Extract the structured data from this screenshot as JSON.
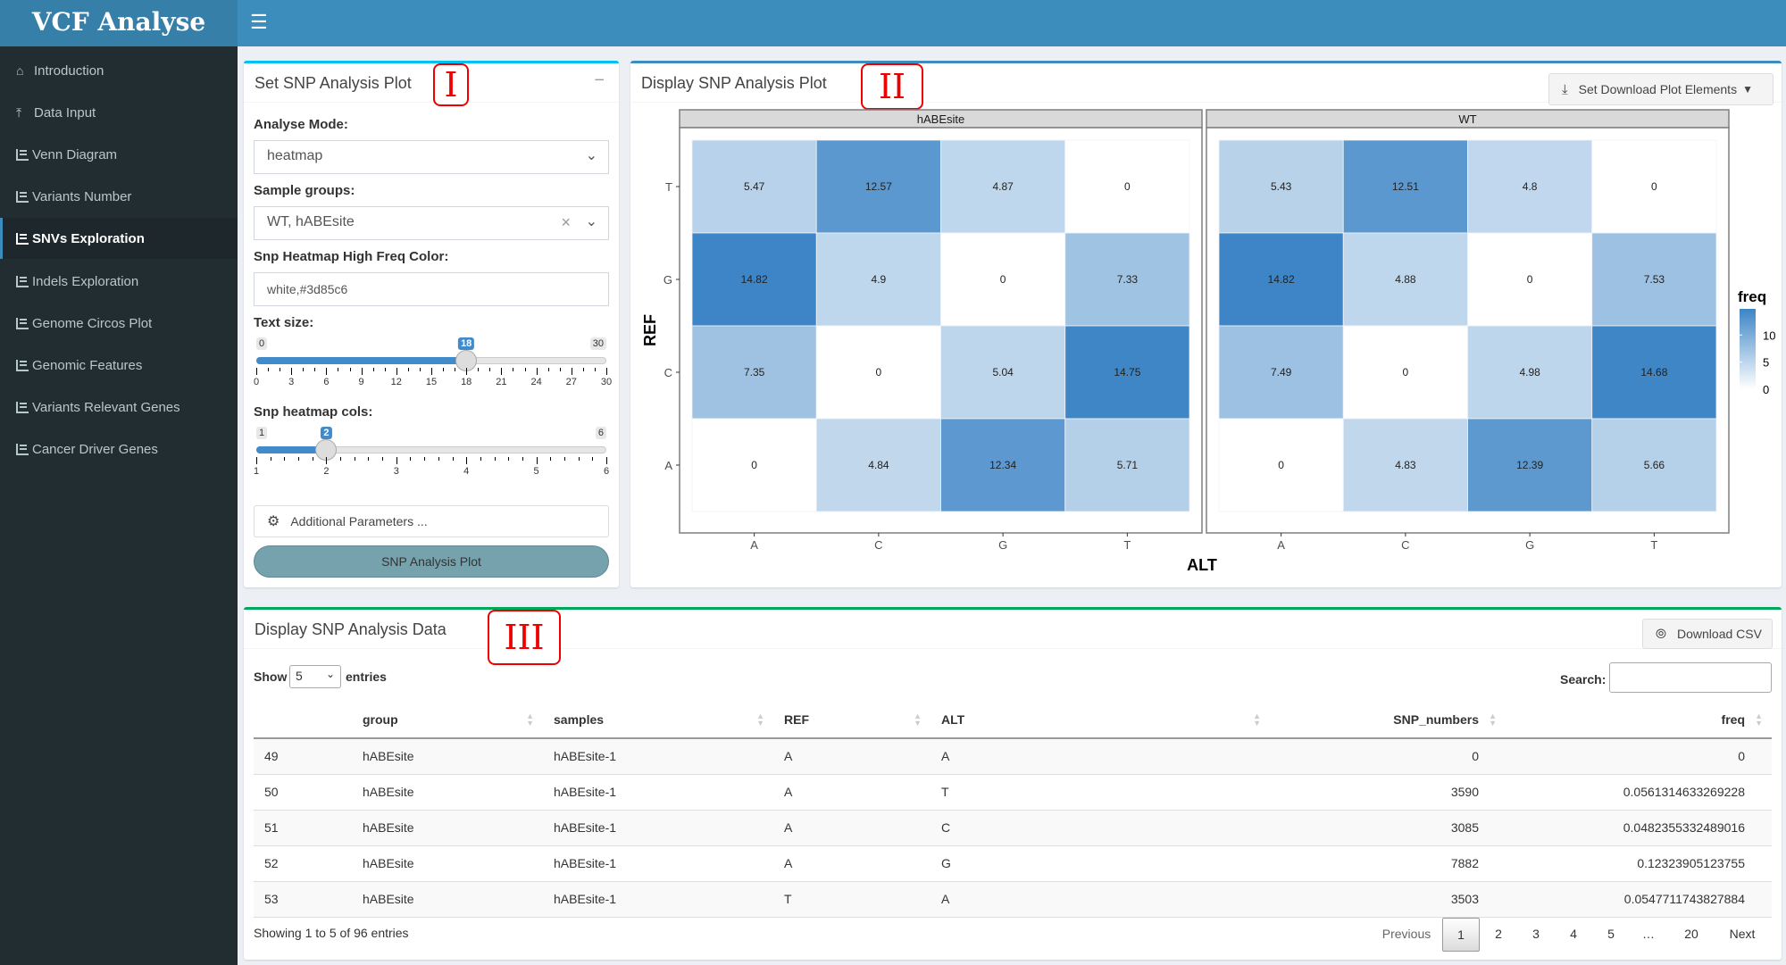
{
  "app": {
    "title": "VCF Analyse",
    "menu_icon": "hamburger-icon"
  },
  "sidebar": {
    "items": [
      {
        "label": "Introduction",
        "icon": "home-icon",
        "active": false
      },
      {
        "label": "Data Input",
        "icon": "upload-icon",
        "active": false
      },
      {
        "label": "Venn Diagram",
        "icon": "bar-chart-icon",
        "active": false
      },
      {
        "label": "Variants Number",
        "icon": "bar-chart-icon",
        "active": false
      },
      {
        "label": "SNVs Exploration",
        "icon": "bar-chart-icon",
        "active": true
      },
      {
        "label": "Indels Exploration",
        "icon": "bar-chart-icon",
        "active": false
      },
      {
        "label": "Genome Circos Plot",
        "icon": "bar-chart-icon",
        "active": false
      },
      {
        "label": "Genomic Features",
        "icon": "bar-chart-icon",
        "active": false
      },
      {
        "label": "Variants Relevant Genes",
        "icon": "bar-chart-icon",
        "active": false
      },
      {
        "label": "Cancer Driver Genes",
        "icon": "bar-chart-icon",
        "active": false
      }
    ]
  },
  "markers": {
    "panel1": "I",
    "panel2": "II",
    "panel3": "III"
  },
  "settings_panel": {
    "title": "Set SNP Analysis Plot",
    "collapse_label": "−",
    "analyse_mode": {
      "label": "Analyse Mode:",
      "value": "heatmap"
    },
    "sample_groups": {
      "label": "Sample groups:",
      "value": "WT, hABEsite",
      "clear": "×"
    },
    "high_freq_color": {
      "label": "Snp Heatmap High Freq Color:",
      "value": "white,#3d85c6"
    },
    "text_size": {
      "label": "Text size:",
      "min": 0,
      "max": 30,
      "value": 18,
      "step_labels": [
        "0",
        "3",
        "6",
        "9",
        "12",
        "15",
        "18",
        "21",
        "24",
        "27",
        "30"
      ]
    },
    "heatmap_cols": {
      "label": "Snp heatmap cols:",
      "min": 1,
      "max": 6,
      "value": 2,
      "step_labels": [
        "1",
        "2",
        "3",
        "4",
        "5",
        "6"
      ]
    },
    "additional_params": "Additional Parameters ...",
    "plot_button": "SNP Analysis Plot"
  },
  "plot_panel": {
    "title": "Display SNP Analysis Plot",
    "download_button": "Set Download Plot Elements"
  },
  "chart_data": {
    "type": "heatmap",
    "title": "",
    "xlabel": "ALT",
    "ylabel": "REF",
    "x_categories": [
      "A",
      "C",
      "G",
      "T"
    ],
    "y_categories": [
      "A",
      "C",
      "G",
      "T"
    ],
    "color_low": "#ffffff",
    "color_high": "#3d85c6",
    "value_range": [
      0,
      14.82
    ],
    "legend": {
      "title": "freq",
      "ticks": [
        0,
        5,
        10
      ],
      "position": "right"
    },
    "facets": [
      {
        "name": "hABEsite",
        "values": {
          "T": [
            5.47,
            12.57,
            4.87,
            0
          ],
          "G": [
            14.82,
            4.9,
            0,
            7.33
          ],
          "C": [
            7.35,
            0,
            5.04,
            14.75
          ],
          "A": [
            0,
            4.84,
            12.34,
            5.71
          ]
        }
      },
      {
        "name": "WT",
        "values": {
          "T": [
            5.43,
            12.51,
            4.8,
            0
          ],
          "G": [
            14.82,
            4.88,
            0,
            7.53
          ],
          "C": [
            7.49,
            0,
            4.98,
            14.68
          ],
          "A": [
            0,
            4.83,
            12.39,
            5.66
          ]
        }
      }
    ]
  },
  "data_panel": {
    "title": "Display SNP Analysis Data",
    "download_csv": "Download CSV",
    "show_label": "Show",
    "entries_label": "entries",
    "page_length": "5",
    "search_label": "Search:",
    "search_value": "",
    "columns": [
      "",
      "group",
      "samples",
      "REF",
      "ALT",
      "SNP_numbers",
      "freq"
    ],
    "rows": [
      [
        "49",
        "hABEsite",
        "hABEsite-1",
        "A",
        "A",
        "0",
        "0"
      ],
      [
        "50",
        "hABEsite",
        "hABEsite-1",
        "A",
        "T",
        "3590",
        "0.0561314633269228"
      ],
      [
        "51",
        "hABEsite",
        "hABEsite-1",
        "A",
        "C",
        "3085",
        "0.0482355332489016"
      ],
      [
        "52",
        "hABEsite",
        "hABEsite-1",
        "A",
        "G",
        "7882",
        "0.12323905123755"
      ],
      [
        "53",
        "hABEsite",
        "hABEsite-1",
        "T",
        "A",
        "3503",
        "0.0547711743827884"
      ]
    ],
    "info": "Showing 1 to 5 of 96 entries",
    "pagination": {
      "previous": "Previous",
      "pages": [
        "1",
        "2",
        "3",
        "4",
        "5",
        "…",
        "20"
      ],
      "current": "1",
      "next": "Next"
    }
  }
}
